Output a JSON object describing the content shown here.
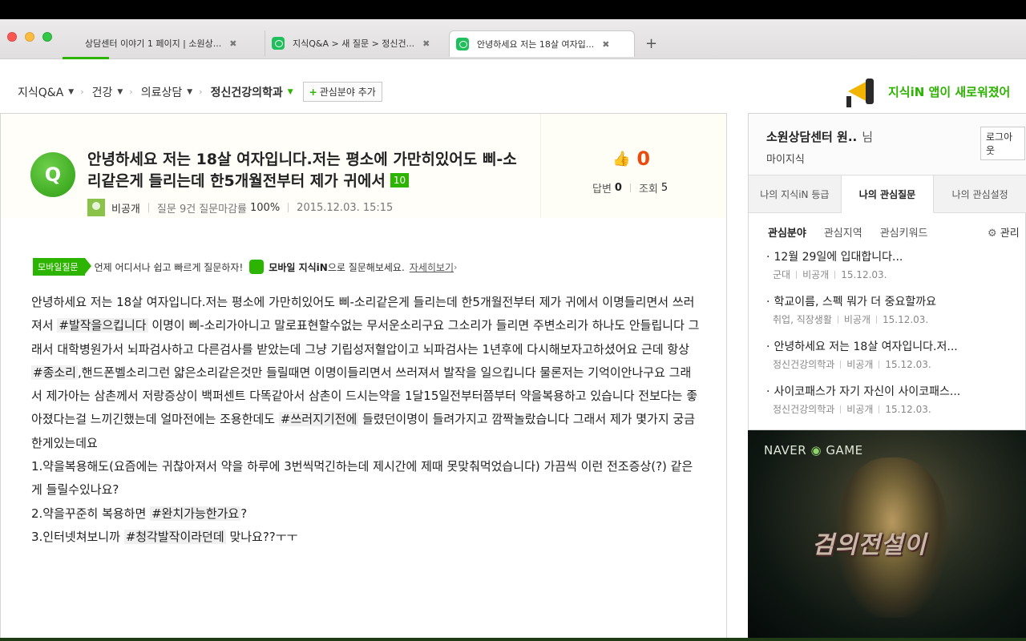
{
  "browser": {
    "tabs": [
      {
        "title": "상담센터 이야기 1 페이지 | 소원상...",
        "close": "✖"
      },
      {
        "title": "지식Q&A > 새 질문 > 정신건...",
        "close": "✖"
      },
      {
        "title": "안녕하세요 저는 18살 여자입...",
        "close": "✖"
      }
    ],
    "new_tab": "+"
  },
  "breadcrumb": {
    "items": [
      "지식Q&A",
      "건강",
      "의료상담",
      "정신건강의학과"
    ],
    "add_interest": "관심분야 추가"
  },
  "promo": {
    "text": "지식iN 앱이 새로워졌어"
  },
  "question": {
    "badge": "Q",
    "title": "안녕하세요 저는 18살 여자입니다.저는 평소에 가만히있어도 삐-소리같은게 들리는데 한5개월전부터 제가 귀에서",
    "level": "10",
    "author": "비공개",
    "question_count": "질문 9건",
    "close_rate_label": "질문마감률",
    "close_rate": "100%",
    "date": "2015.12.03. 15:15",
    "likes": "0",
    "answers_label": "답변",
    "answers": "0",
    "views_label": "조회",
    "views": "5"
  },
  "mobile_banner": {
    "tag": "모바일질문",
    "text1": "언제 어디서나 쉽고 빠르게 질문하자!",
    "brand": "모바일 지식iN",
    "text2": "으로 질문해보세요.",
    "link": "자세히보기"
  },
  "body": {
    "p1_a": "안녕하세요 저는 18살 여자입니다.저는 평소에 가만히있어도 삐-소리같은게 들리는데 한5개월전부터 제가 귀에서 이명들리면서 쓰러져서 ",
    "tag1": "#발작을으킵니다",
    "p1_b": " 이명이 삐-소리가아니고 말로표현할수없는 무서운소리구요 그소리가 들리면 주변소리가 하나도 안들립니다 그래서 대학병원가서 뇌파검사하고 다른검사를 받았는데 그냥 기립성저혈압이고 뇌파검사는 1년후에 다시해보자고하셨어요 근데 항상 ",
    "tag2": "#종소리",
    "p1_c": ",핸드폰벨소리그런 얇은소리같은것만 들릴때면 이명이들리면서 쓰러져서 발작을 일으킵니다 물론저는 기억이안나구요 그래서 제가아는 삼촌께서 저랑증상이 백퍼센트 다똑같아서 삼촌이 드시는약을 1달15일전부터쯤부터 약을복용하고 있습니다 전보다는 좋아졌다는걸 느끼긴했는데 얼마전에는 조용한데도 ",
    "tag3": "#쓰러지기전에",
    "p1_d": " 들렸던이명이 들려가지고 깜짝놀랐습니다 그래서 제가 몇가지 궁금한게있는데요",
    "q1": "1.약을복용해도(요즘에는 귀찮아져서 약을 하루에 3번씩먹긴하는데 제시간에 제때 못맞춰먹었습니다) 가끔씩 이런 전조증상(?) 같은게 들릴수있나요?",
    "q2_a": "2.약을꾸준히 복용하면 ",
    "tag4": "#완치가능한가요",
    "q2_b": "?",
    "q3_a": "3.인터넷쳐보니까 ",
    "tag5": "#청각발작이라던데",
    "q3_b": " 맞나요??ㅜㅜ"
  },
  "sidebar": {
    "user_name": "소원상담센터 원..",
    "user_suffix": "님",
    "my_knowledge": "마이지식",
    "logout": "로그아웃",
    "tabs": [
      "나의 지식iN 등급",
      "나의 관심질문",
      "나의 관심설정"
    ],
    "subtabs": [
      "관심분야",
      "관심지역",
      "관심키워드"
    ],
    "manage": "관리",
    "items": [
      {
        "title": "12월 29일에 입대합니다...",
        "cat": "군대",
        "author": "비공개",
        "date": "15.12.03."
      },
      {
        "title": "학교이름, 스펙 뭐가 더 중요할까요",
        "cat": "취업, 직장생활",
        "author": "비공개",
        "date": "15.12.03."
      },
      {
        "title": "안녕하세요 저는 18살 여자입니다.저...",
        "cat": "정신건강의학과",
        "author": "비공개",
        "date": "15.12.03."
      },
      {
        "title": "사이코패스가 자기 자신이 사이코패스...",
        "cat": "정신건강의학과",
        "author": "비공개",
        "date": "15.12.03."
      }
    ]
  },
  "ad": {
    "logo_a": "NAVER",
    "logo_b": "GAME",
    "title": "검의전설이"
  },
  "colors": {
    "naver_green": "#2db400",
    "like_orange": "#e84c0f"
  }
}
